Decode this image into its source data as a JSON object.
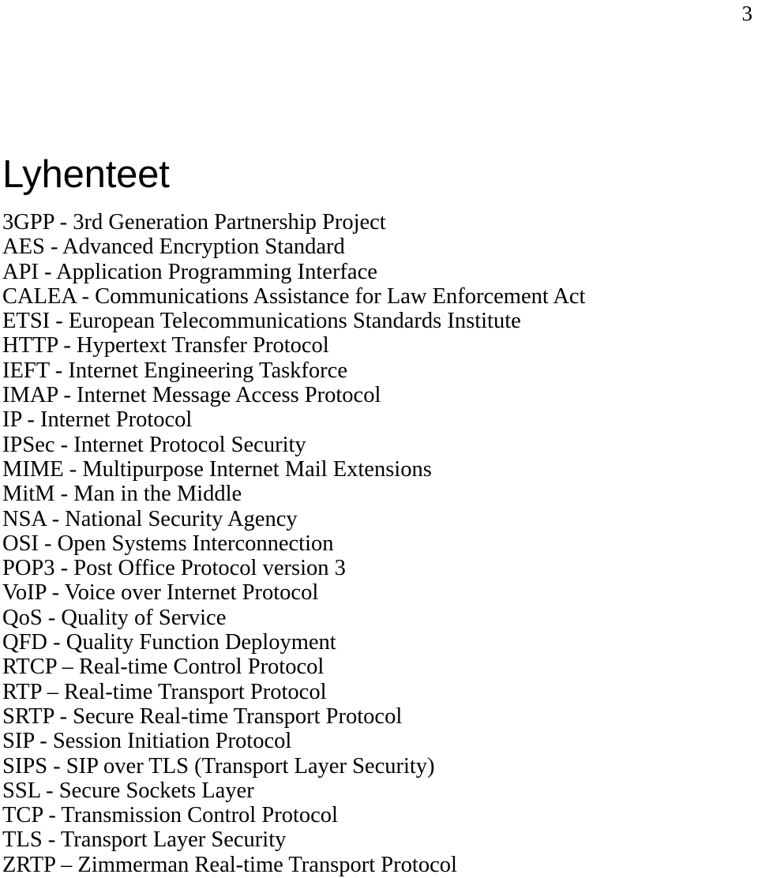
{
  "document": {
    "page_number": "3",
    "title": "Lyhenteet",
    "abbreviations": [
      "3GPP - 3rd Generation Partnership Project",
      "AES - Advanced Encryption Standard",
      "API - Application Programming Interface",
      "CALEA - Communications Assistance for Law Enforcement Act",
      "ETSI - European Telecommunications Standards Institute",
      "HTTP - Hypertext Transfer Protocol",
      "IEFT - Internet Engineering Taskforce",
      "IMAP - Internet Message Access Protocol",
      "IP - Internet Protocol",
      "IPSec - Internet Protocol Security",
      "MIME - Multipurpose Internet Mail Extensions",
      "MitM - Man in the Middle",
      "NSA - National Security Agency",
      "OSI - Open Systems Interconnection",
      "POP3 - Post Office Protocol version 3",
      "VoIP - Voice over Internet Protocol",
      "QoS - Quality of Service",
      "QFD - Quality Function Deployment",
      "RTCP – Real-time Control Protocol",
      "RTP – Real-time Transport Protocol",
      "SRTP - Secure Real-time Transport Protocol",
      "SIP - Session Initiation Protocol",
      "SIPS - SIP over TLS (Transport Layer Security)",
      "SSL - Secure Sockets Layer",
      "TCP - Transmission Control Protocol",
      "TLS - Transport Layer Security",
      "ZRTP – Zimmerman Real-time Transport Protocol"
    ]
  },
  "colors": {
    "page_background": "#ffffff",
    "text": "#000000"
  }
}
